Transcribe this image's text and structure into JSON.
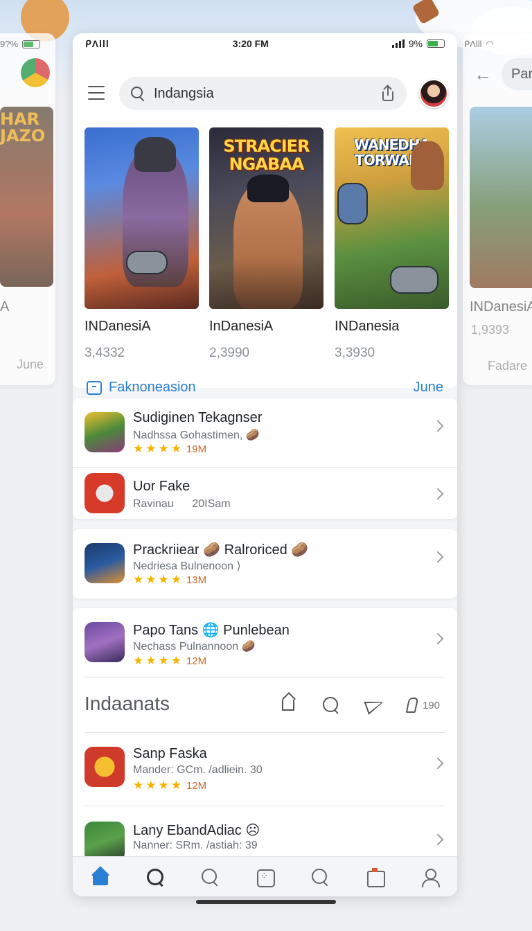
{
  "status": {
    "carrier": "ᑭɅlll",
    "time": "3:20 FM",
    "battery": "9%"
  },
  "side_left": {
    "battery": "9?%",
    "banner": "HAR\nJAZO",
    "name": "A",
    "footer": "June"
  },
  "side_right": {
    "carrier": "ᑭɅlll",
    "search_text": "Par",
    "name": "INDanesiA",
    "count": "1,9393",
    "footer": "Fadare"
  },
  "search": {
    "value": "Indangsia"
  },
  "games": [
    {
      "banner": "",
      "name": "INDanesiA",
      "count": "3,4332"
    },
    {
      "banner": "STRACIER NGABAA",
      "name": "InDanesiA",
      "count": "2,3990"
    },
    {
      "banner": "WANEDHA TORWADS",
      "name": "INDanesia",
      "count": "3,3930"
    }
  ],
  "top_footer": {
    "left_label": "Faknoneasion",
    "right_label": "June"
  },
  "list_group_1": [
    {
      "title": "Sudiginen Tekagnser",
      "sub": "Nadhssa Gohastimen, 🥔",
      "stars": "★★★★",
      "size": "19M"
    },
    {
      "title": "Uor Fake",
      "sub": "Ravinau      20ISam",
      "stars": "",
      "size": ""
    }
  ],
  "list_group_2": [
    {
      "title": "Prackriiear 🥔 Ralroriced 🥔",
      "sub": "Nedriesa Bulnenoon ⟩",
      "stars": "★★★★",
      "size": "13M"
    }
  ],
  "list_group_3": [
    {
      "title": "Papo Tans 🌐 Punlebean",
      "sub": "Nechass Pulnannoon 🥔",
      "stars": "★★★★",
      "size": "12M"
    }
  ],
  "section": {
    "heading": "Indaanats",
    "like_count": "190"
  },
  "list_group_4": [
    {
      "title": "Sanp Faska",
      "sub": "Mander: GCm. /adliein. 30",
      "stars": "★★★★",
      "size": "12M"
    },
    {
      "title": "Lany EbandAdiac ☹",
      "sub": "Nanner: SRm. /astiah: 39",
      "stars": "",
      "size": ""
    }
  ],
  "colors": {
    "accent": "#2a7fd4",
    "star": "#f5b400",
    "size_text": "#d0682b"
  }
}
